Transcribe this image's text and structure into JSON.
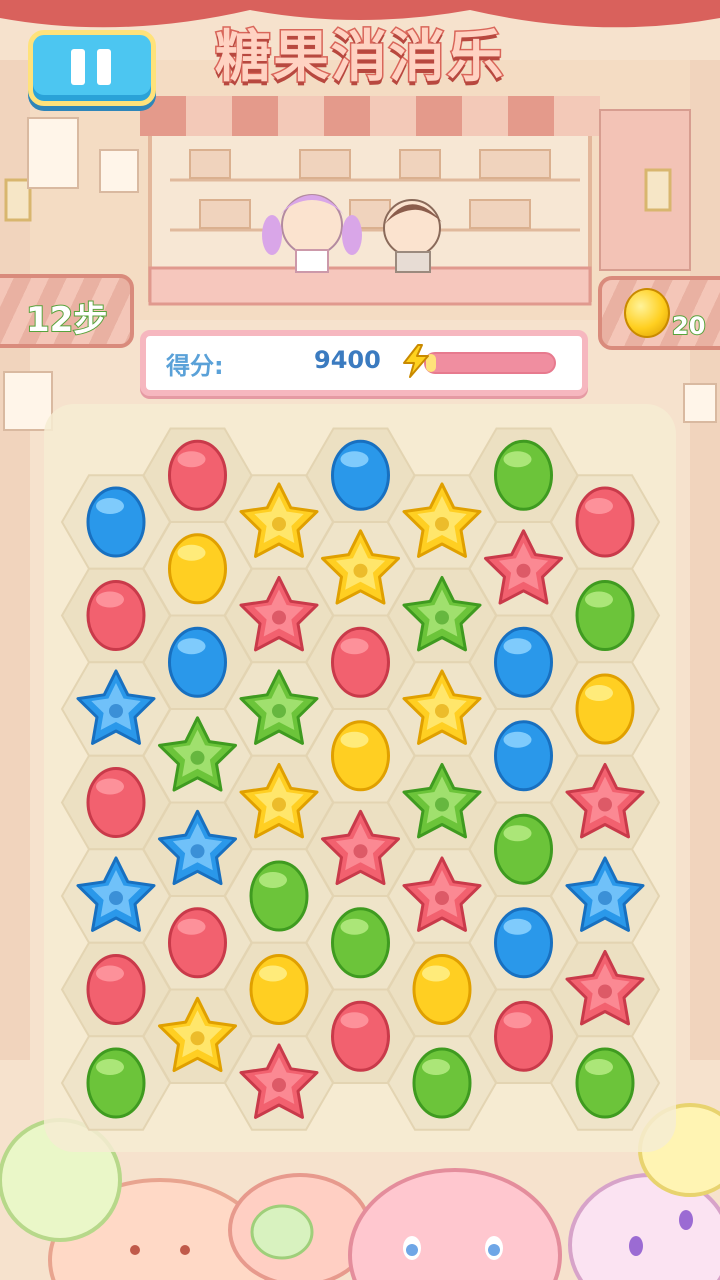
{
  "title": "糖果消消乐",
  "hud": {
    "steps": "12步",
    "coins": "20",
    "score_label": "得分:",
    "score_value": "9400",
    "score_progress": 0.05
  },
  "icons": {
    "pause": "pause-icon",
    "coin": "coin-icon",
    "bolt": "lightning-bolt-icon"
  },
  "colors": {
    "red": "#f2616f",
    "blue": "#2a98ea",
    "green": "#6cc43a",
    "yellow": "#ffcf22"
  },
  "board": {
    "columns": 7,
    "rows": 8,
    "layout": "hexagonal, odd columns offset downward by half a cell",
    "cells": [
      [
        "blue-bean",
        "red-bean",
        "blue-star",
        "red-bean",
        "blue-star",
        "red-bean",
        "green-bean"
      ],
      [
        "red-bean",
        "yellow-bean",
        "blue-bean",
        "green-star",
        "blue-star",
        "red-bean",
        "yellow-star"
      ],
      [
        "yellow-star",
        "red-star",
        "green-star",
        "yellow-star",
        "green-bean",
        "yellow-bean",
        "red-star"
      ],
      [
        "blue-bean",
        "yellow-star",
        "red-bean",
        "yellow-bean",
        "red-star",
        "green-bean",
        "red-bean"
      ],
      [
        "yellow-star",
        "green-star",
        "yellow-star",
        "green-star",
        "red-star",
        "yellow-bean",
        "green-bean"
      ],
      [
        "green-bean",
        "red-star",
        "blue-bean",
        "blue-bean",
        "green-bean",
        "blue-bean",
        "red-bean"
      ],
      [
        "red-bean",
        "green-bean",
        "yellow-bean",
        "red-star",
        "blue-star",
        "red-star",
        "green-bean"
      ]
    ]
  }
}
